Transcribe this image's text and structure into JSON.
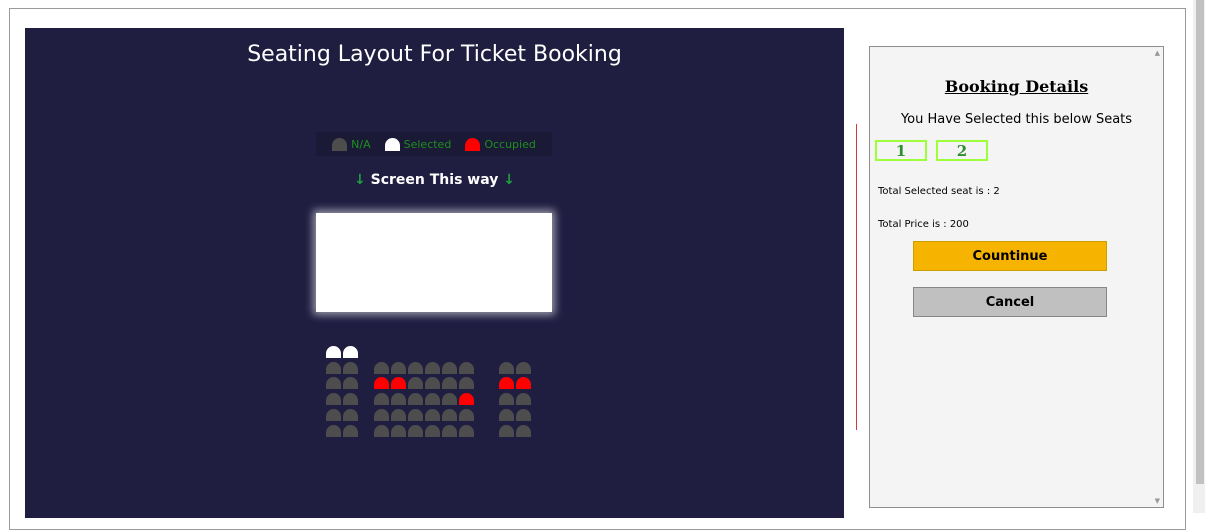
{
  "cinema": {
    "title": "Seating Layout For Ticket Booking",
    "screen_label": "Screen This way",
    "legend": [
      {
        "label": "N/A",
        "color": "#4d4d4d"
      },
      {
        "label": "Selected",
        "color": "#ffffff"
      },
      {
        "label": "Occupied",
        "color": "#ff0000"
      }
    ]
  },
  "seat_colors": {
    "na": "#4d4d4d",
    "selected": "#ffffff",
    "occupied": "#ff0000"
  },
  "seats": [
    [
      "selected",
      "selected",
      "",
      "",
      "",
      "",
      "",
      "",
      "",
      "",
      ""
    ],
    [
      "na",
      "na",
      "na",
      "na",
      "na",
      "na",
      "na",
      "na",
      "na",
      "na"
    ],
    [
      "na",
      "na",
      "occupied",
      "occupied",
      "na",
      "na",
      "na",
      "na",
      "occupied",
      "occupied"
    ],
    [
      "na",
      "na",
      "na",
      "na",
      "na",
      "na",
      "na",
      "occupied",
      "na",
      "na"
    ],
    [
      "na",
      "na",
      "na",
      "na",
      "na",
      "na",
      "na",
      "na",
      "na",
      "na"
    ],
    [
      "na",
      "na",
      "na",
      "na",
      "na",
      "na",
      "na",
      "na",
      "na",
      "na"
    ]
  ],
  "booking": {
    "title": "Booking Details",
    "subtitle": "You Have Selected this below Seats",
    "selected_seats": [
      "1",
      "2"
    ],
    "total_seat_text": "Total Selected seat is : 2",
    "total_price_text": "Total Price is : 200",
    "continue_label": "Countinue",
    "cancel_label": "Cancel"
  }
}
